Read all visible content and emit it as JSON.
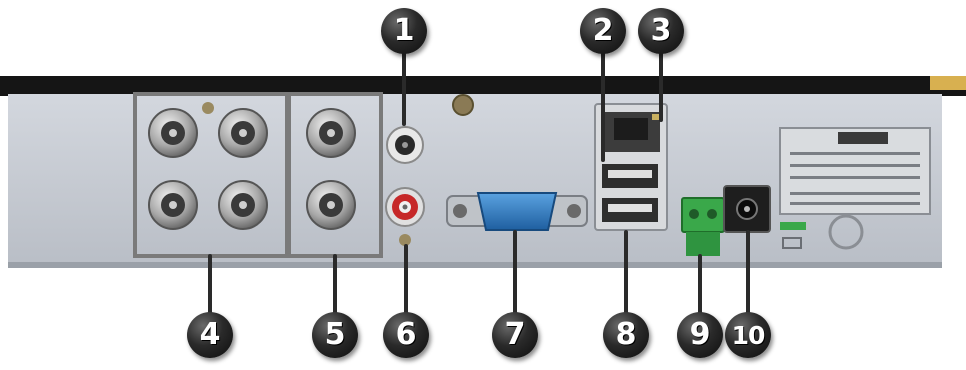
{
  "panel_colors": {
    "background": "#ffffff",
    "top_bar": "#1a1a1a",
    "panel": "#c9cdd4",
    "panel_shadow": "#9aa0a8",
    "accent_gold": "#d8b050",
    "rca_red": "#c62828",
    "terminal_green": "#3aa84a",
    "vga_blue": "#2f7fc9",
    "outline_box": "#7a7a7a"
  },
  "callouts": [
    {
      "number": "1"
    },
    {
      "number": "2"
    },
    {
      "number": "3"
    },
    {
      "number": "4"
    },
    {
      "number": "5"
    },
    {
      "number": "6"
    },
    {
      "number": "7"
    },
    {
      "number": "8"
    },
    {
      "number": "9"
    },
    {
      "number": "10"
    }
  ]
}
